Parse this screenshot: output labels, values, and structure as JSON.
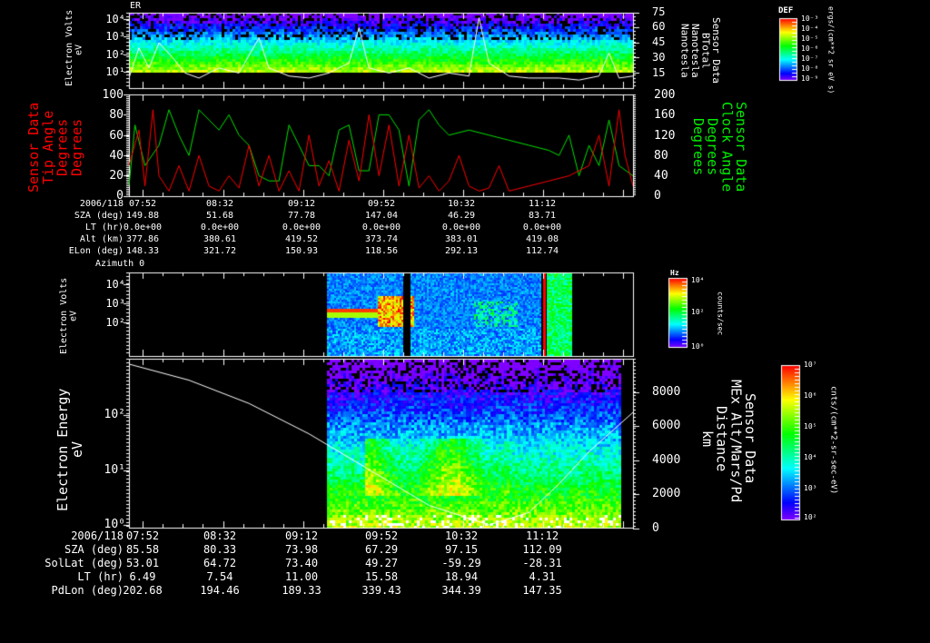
{
  "top_title": "ER",
  "azimuth_title": "Azimuth 0",
  "colors": {
    "red": "#ff0000",
    "green": "#00e000",
    "white": "#ffffff",
    "bg": "#000000"
  },
  "panel1": {
    "ylabel": [
      "Electron Volts",
      "eV"
    ],
    "yticks": [
      "10⁴",
      "10³",
      "10²",
      "10¹"
    ],
    "right_ticks": [
      "75",
      "60",
      "45",
      "30",
      "15"
    ],
    "right_label": [
      "Sensor Data",
      "BTotal",
      "Nanotesla",
      "Nanotesla"
    ]
  },
  "panel2": {
    "left_label": [
      "Sensor Data",
      "Tip Angle",
      "Degrees",
      "Degrees"
    ],
    "left_ticks": [
      "100",
      "80",
      "60",
      "40",
      "20",
      "0"
    ],
    "right_label": [
      "Sensor Data",
      "Clock Angle",
      "Degrees",
      "Degrees"
    ],
    "right_ticks": [
      "200",
      "160",
      "120",
      "80",
      "40",
      "0"
    ]
  },
  "colorbar1": {
    "title": "DEF",
    "ticks": [
      "10⁻³",
      "10⁻⁴",
      "10⁻⁵",
      "10⁻⁶",
      "10⁻⁷",
      "10⁻⁸",
      "10⁻⁹"
    ],
    "unit": "ergs/(cm**2 sr eV s)"
  },
  "table1": {
    "rows": [
      {
        "label": "2006/118",
        "values": [
          "07:52",
          "08:32",
          "09:12",
          "09:52",
          "10:32",
          "11:12"
        ]
      },
      {
        "label": "SZA (deg)",
        "values": [
          "149.88",
          "51.68",
          "77.78",
          "147.04",
          "46.29",
          "83.71"
        ]
      },
      {
        "label": "LT (hr)",
        "values": [
          "0.0e+00",
          "0.0e+00",
          "0.0e+00",
          "0.0e+00",
          "0.0e+00",
          "0.0e+00"
        ]
      },
      {
        "label": "Alt (km)",
        "values": [
          "377.86",
          "380.61",
          "419.52",
          "373.74",
          "383.01",
          "419.08"
        ]
      },
      {
        "label": "ELon (deg)",
        "values": [
          "148.33",
          "321.72",
          "150.93",
          "118.56",
          "292.13",
          "112.74"
        ]
      }
    ]
  },
  "panel3": {
    "ylabel": [
      "Electron Volts",
      "eV"
    ],
    "yticks": [
      "10⁴",
      "10³",
      "10²"
    ]
  },
  "colorbar2": {
    "title": "Hz",
    "ticks": [
      "10⁴",
      "10²",
      "10⁰"
    ],
    "unit": "counts/sec"
  },
  "panel4": {
    "ylabel": [
      "Electron Energy",
      "eV"
    ],
    "yticks": [
      "10²",
      "10¹",
      "10⁰"
    ],
    "right_ticks": [
      "8000",
      "6000",
      "4000",
      "2000",
      "0"
    ],
    "right_label": [
      "Sensor Data",
      "MEx Alt/Mars/Pd",
      "Distance",
      "km"
    ]
  },
  "colorbar3": {
    "ticks": [
      "10⁷",
      "10⁶",
      "10⁵",
      "10⁴",
      "10³",
      "10²"
    ],
    "unit": "cnts/(cm**2-sr-sec-eV)"
  },
  "table2": {
    "rows": [
      {
        "label": "2006/118",
        "values": [
          "07:52",
          "08:32",
          "09:12",
          "09:52",
          "10:32",
          "11:12"
        ]
      },
      {
        "label": "SZA (deg)",
        "values": [
          "85.58",
          "80.33",
          "73.98",
          "67.29",
          "97.15",
          "112.09"
        ]
      },
      {
        "label": "SolLat (deg)",
        "values": [
          "53.01",
          "64.72",
          "73.40",
          "49.27",
          "-59.29",
          "-28.31"
        ]
      },
      {
        "label": "LT (hr)",
        "values": [
          "6.49",
          "7.54",
          "11.00",
          "15.58",
          "18.94",
          "4.31"
        ]
      },
      {
        "label": "PdLon (deg)",
        "values": [
          "202.68",
          "194.46",
          "189.33",
          "339.43",
          "344.39",
          "147.35"
        ]
      }
    ]
  },
  "chart_data": [
    {
      "type": "line",
      "title": "BTotal",
      "x_unit": "minutes after 07:45",
      "ylabel": "Nanotesla",
      "ylim": [
        0,
        75
      ],
      "x": [
        0,
        5,
        10,
        15,
        22,
        28,
        35,
        45,
        55,
        65,
        70,
        80,
        90,
        100,
        110,
        115,
        120,
        130,
        140,
        150,
        160,
        170,
        175,
        180,
        190,
        200,
        215,
        225,
        235,
        240,
        245,
        252
      ],
      "y": [
        10,
        40,
        20,
        45,
        30,
        15,
        10,
        20,
        15,
        50,
        20,
        12,
        10,
        15,
        25,
        60,
        20,
        15,
        20,
        10,
        15,
        12,
        70,
        25,
        12,
        10,
        10,
        8,
        12,
        35,
        10,
        12
      ]
    },
    {
      "type": "line",
      "title": "Tip Angle",
      "ylabel": "Degrees",
      "ylim": [
        0,
        100
      ],
      "color": "red",
      "x": [
        0,
        5,
        8,
        12,
        15,
        20,
        25,
        30,
        35,
        40,
        45,
        50,
        55,
        60,
        65,
        70,
        75,
        80,
        85,
        90,
        95,
        100,
        105,
        110,
        115,
        120,
        125,
        130,
        135,
        140,
        145,
        150,
        155,
        160,
        165,
        170,
        175,
        180,
        185,
        190,
        200,
        210,
        220,
        230,
        235,
        240,
        245,
        248,
        252
      ],
      "y": [
        30,
        65,
        10,
        85,
        20,
        5,
        30,
        5,
        40,
        10,
        5,
        20,
        8,
        50,
        10,
        40,
        5,
        25,
        5,
        60,
        10,
        35,
        5,
        55,
        15,
        80,
        20,
        70,
        10,
        60,
        8,
        20,
        5,
        15,
        40,
        10,
        5,
        8,
        30,
        5,
        10,
        15,
        20,
        30,
        60,
        10,
        85,
        40,
        10
      ]
    },
    {
      "type": "line",
      "title": "Clock Angle",
      "ylabel": "Degrees",
      "ylim": [
        0,
        200
      ],
      "color": "green",
      "x": [
        0,
        3,
        8,
        15,
        20,
        25,
        30,
        35,
        40,
        45,
        50,
        55,
        60,
        65,
        70,
        75,
        80,
        85,
        90,
        95,
        100,
        105,
        110,
        115,
        120,
        125,
        130,
        135,
        140,
        145,
        150,
        155,
        160,
        170,
        180,
        190,
        200,
        210,
        215,
        220,
        225,
        230,
        235,
        240,
        245,
        252
      ],
      "y": [
        20,
        140,
        60,
        100,
        170,
        120,
        80,
        170,
        150,
        130,
        160,
        120,
        100,
        40,
        30,
        30,
        140,
        100,
        60,
        60,
        40,
        130,
        140,
        50,
        50,
        160,
        160,
        130,
        20,
        150,
        170,
        140,
        120,
        130,
        120,
        110,
        100,
        90,
        80,
        120,
        40,
        100,
        60,
        150,
        60,
        40
      ]
    },
    {
      "type": "line",
      "title": "MEx Alt/Mars/Pd Distance",
      "ylabel": "km",
      "ylim": [
        0,
        9500
      ],
      "x": [
        0,
        30,
        60,
        90,
        120,
        150,
        180,
        200,
        215,
        230,
        252
      ],
      "y": [
        9200,
        8300,
        7000,
        5300,
        3300,
        1300,
        200,
        900,
        2500,
        4300,
        6500
      ]
    }
  ]
}
